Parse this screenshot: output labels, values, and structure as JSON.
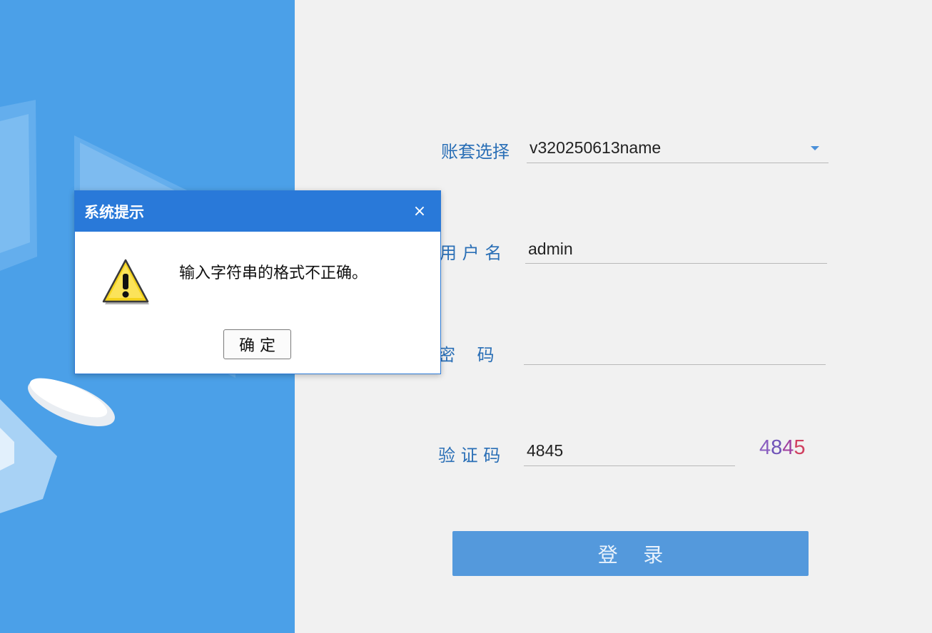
{
  "form": {
    "account_label": "账套选择",
    "account_value": "v320250613name",
    "username_label": "用 户 名",
    "username_value": "admin",
    "password_label": "密    码",
    "password_value": "",
    "captcha_label": "验 证 码",
    "captcha_value": "4845",
    "captcha_image_text": [
      "4",
      "8",
      "4",
      "5"
    ],
    "login_button": "登    录"
  },
  "dialog": {
    "title": "系统提示",
    "close_symbol": "×",
    "message": "输入字符串的格式不正确。",
    "ok_button": "确 定",
    "icon": "warning-icon"
  },
  "colors": {
    "left_panel": "#4ba0e8",
    "label": "#2a6fb6",
    "login_button": "#5499dc",
    "dialog_title_bar": "#2979d9"
  }
}
